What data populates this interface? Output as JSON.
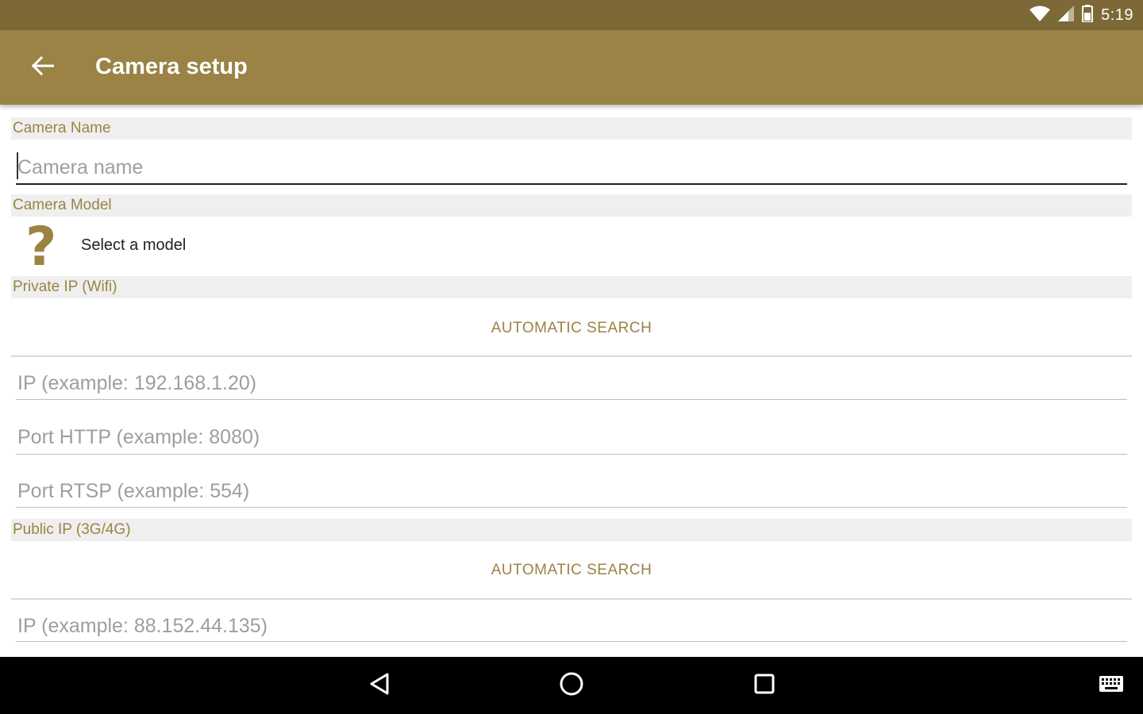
{
  "status_bar": {
    "time": "5:19",
    "icons": [
      "wifi-icon",
      "signal-icon",
      "battery-icon"
    ]
  },
  "app_bar": {
    "title": "Camera setup",
    "back_icon": "arrow-left-icon"
  },
  "sections": {
    "camera_name": {
      "header": "Camera Name",
      "field_placeholder": "Camera name"
    },
    "camera_model": {
      "header": "Camera Model",
      "icon": "question-mark-icon",
      "select_label": "Select a model"
    },
    "private_ip": {
      "header": "Private IP (Wifi)",
      "search_label": "AUTOMATIC SEARCH",
      "ip_placeholder": "IP (example: 192.168.1.20)",
      "http_placeholder": "Port HTTP (example: 8080)",
      "rtsp_placeholder": "Port RTSP (example: 554)"
    },
    "public_ip": {
      "header": "Public IP (3G/4G)",
      "search_label": "AUTOMATIC SEARCH",
      "ip_placeholder": "IP (example: 88.152.44.135)"
    }
  },
  "nav_bar": {
    "icons": [
      "back-triangle-icon",
      "home-circle-icon",
      "recents-square-icon",
      "keyboard-icon"
    ]
  },
  "colors": {
    "status_bar": "#7d6937",
    "app_bar": "#9a8345",
    "accent": "#9a8345",
    "section_bg": "#efefef"
  }
}
